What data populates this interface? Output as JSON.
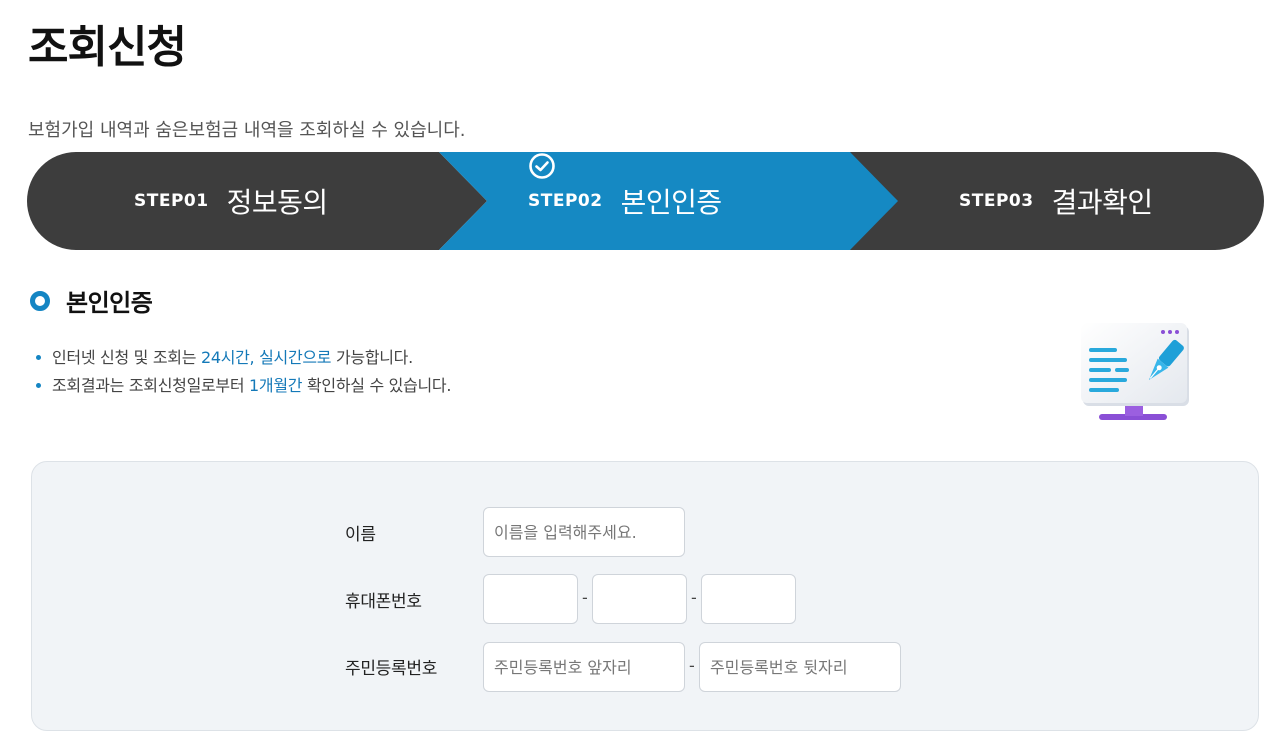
{
  "page": {
    "title": "조회신청",
    "description": "보험가입 내역과 숨은보험금 내역을 조회하실 수 있습니다."
  },
  "steps": [
    {
      "num": "STEP01",
      "name": "정보동의",
      "active": false
    },
    {
      "num": "STEP02",
      "name": "본인인증",
      "active": true
    },
    {
      "num": "STEP03",
      "name": "결과확인",
      "active": false
    }
  ],
  "colors": {
    "step_inactive": "#3d3d3d",
    "step_active": "#1589c3",
    "accent": "#1479b8",
    "form_bg": "#f1f4f7"
  },
  "section": {
    "title": "본인인증",
    "notes": [
      {
        "before": "인터넷 신청 및 조회는 ",
        "highlight": "24시간, 실시간으로",
        "after": " 가능합니다."
      },
      {
        "before": "조회결과는 조회신청일로부터 ",
        "highlight": "1개월간",
        "after": " 확인하실 수 있습니다."
      }
    ]
  },
  "form": {
    "name_label": "이름",
    "name_placeholder": "이름을 입력해주세요.",
    "phone_label": "휴대폰번호",
    "phone_sep": "-",
    "rrn_label": "주민등록번호",
    "rrn_front_placeholder": "주민등록번호 앞자리",
    "rrn_back_placeholder": "주민등록번호 뒷자리",
    "rrn_sep": "-"
  },
  "icons": {
    "step_check": "check-circle-icon",
    "section_marker": "ring-icon",
    "illustration": "monitor-pen-icon"
  }
}
